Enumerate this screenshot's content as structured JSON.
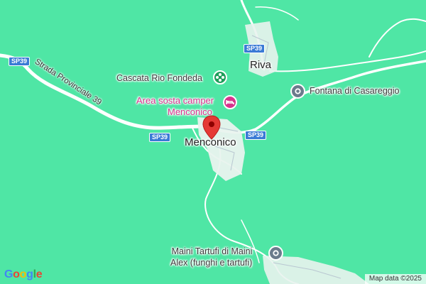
{
  "map": {
    "background": "#4fe6a5",
    "places": {
      "menconico": "Menconico",
      "riva": "Riva"
    },
    "pois": {
      "cascata": "Cascata Rio Fondeda",
      "camper_line1": "Area sosta camper",
      "camper_line2": "Menconico",
      "fontana": "Fontana di Casareggio",
      "maini_line1": "Maini Tartufi di Maini",
      "maini_line2": "Alex (funghi e tartufi)"
    },
    "roads": {
      "sp39_label": "SP39",
      "road_name": "Strada Provinciale 39"
    },
    "marker": {
      "color": "#e53935",
      "icon": "map-pin-icon"
    },
    "colors": {
      "camper": "#d6338d",
      "poi_icon": "#6b7b8c",
      "park_icon": "#1e9e5a",
      "shield": "#3a7bd5"
    }
  },
  "footer": {
    "logo": [
      "G",
      "o",
      "o",
      "g",
      "l",
      "e"
    ],
    "attribution": "Map data ©2025"
  }
}
